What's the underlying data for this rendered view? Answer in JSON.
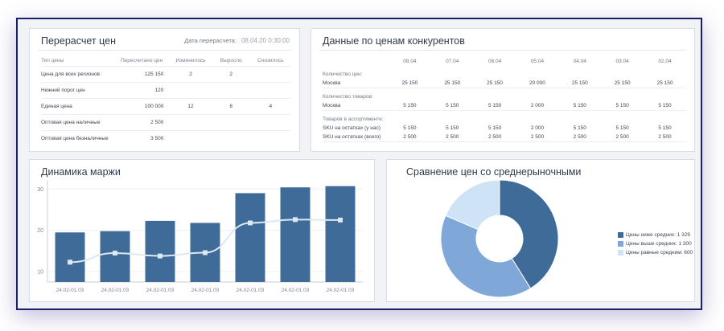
{
  "recalc": {
    "title": "Перерасчет цен",
    "date_label": "Дата перерасчета:",
    "date_value": "08.04.20 0:30:00",
    "headers": [
      "Тип цены",
      "Пересчитано цен",
      "Изменилось",
      "Выросло",
      "Снизилось"
    ],
    "rows": [
      [
        "Цена для всех регионов",
        "125 150",
        "2",
        "2",
        ""
      ],
      [
        "Нижний порог цен",
        "120",
        "",
        "",
        ""
      ],
      [
        "Единая цена",
        "100 000",
        "12",
        "8",
        "4"
      ],
      [
        "Оптовая цена наличные",
        "2 500",
        "",
        "",
        ""
      ],
      [
        "Оптовая цена безналичные",
        "3 500",
        "",
        "",
        ""
      ]
    ]
  },
  "competitors": {
    "title": "Данные по ценам конкурентов",
    "dates": [
      "08.04",
      "07.04",
      "06.04",
      "05.04",
      "04.04",
      "03.04",
      "02.04"
    ],
    "sections": [
      {
        "label": "Количество цен:",
        "rows": [
          {
            "name": "Москва",
            "values": [
              "25 150",
              "25 150",
              "25 150",
              "20 000",
              "25 150",
              "25 150",
              "25 150"
            ]
          }
        ]
      },
      {
        "label": "Количество товаров:",
        "rows": [
          {
            "name": "Москва",
            "values": [
              "5 150",
              "5 150",
              "5 150",
              "2 000",
              "5 150",
              "5 150",
              "5 150"
            ]
          }
        ]
      },
      {
        "label": "Товаров в ассортименте:",
        "rows": [
          {
            "name": "SKU на остатках (у нас)",
            "values": [
              "5 150",
              "5 150",
              "5 150",
              "2 000",
              "5 150",
              "5 150",
              "5 150"
            ]
          },
          {
            "name": "SKU на остатках (всего)",
            "values": [
              "2 500",
              "2 500",
              "2 500",
              "2 500",
              "2 500",
              "2 500",
              "2 500"
            ]
          }
        ]
      }
    ]
  },
  "chart_data": [
    {
      "type": "bar",
      "title": "Динамика маржи",
      "categories": [
        "24.02-01.03",
        "24.02-01.03",
        "24.02-01.03",
        "24.02-01.03",
        "24.02-01.03",
        "24.02-01.03",
        "24.02-01.03"
      ],
      "series": [
        {
          "values": [
            19.5,
            19.8,
            22.3,
            21.8,
            29.0,
            30.4,
            30.7
          ],
          "kind": "bar",
          "color": "#3e6b98"
        },
        {
          "values": [
            12.3,
            14.5,
            13.8,
            14.6,
            21.8,
            22.6,
            22.5
          ],
          "kind": "line",
          "color": "#dce8f3"
        }
      ],
      "yticks": [
        10,
        20,
        30
      ],
      "ylim": [
        7.5,
        32
      ],
      "grid": true
    },
    {
      "type": "pie",
      "title": "Сравнение цен со среднерыночными",
      "donut": true,
      "slices": [
        {
          "label": "Цены ниже средних: 1 329",
          "value": 1329,
          "color": "#3e6b98"
        },
        {
          "label": "Цены выше средних: 1 300",
          "value": 1300,
          "color": "#7fa8d8"
        },
        {
          "label": "Цены равные средним: 600",
          "value": 600,
          "color": "#cfe3f7"
        }
      ],
      "legend": "right"
    }
  ]
}
